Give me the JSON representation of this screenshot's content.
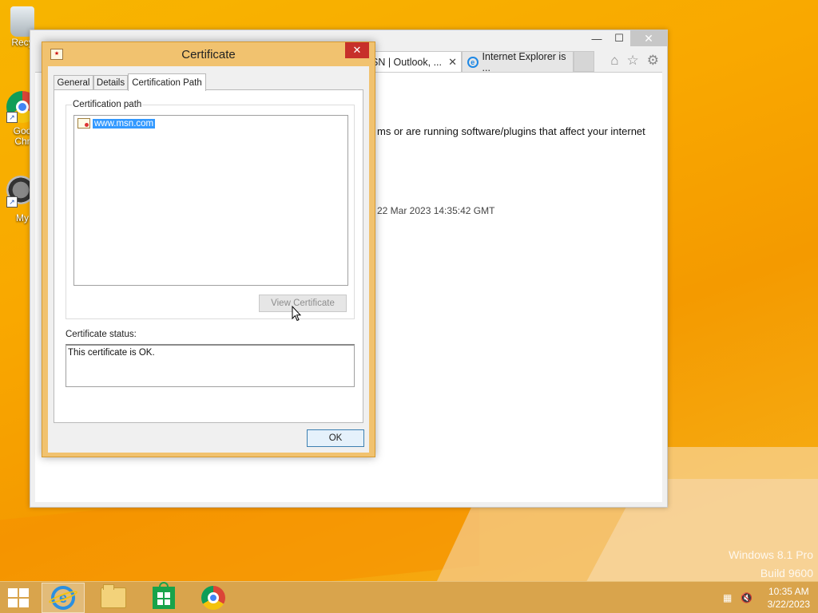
{
  "desktop": {
    "icons": [
      {
        "label": "Recycle Bin",
        "visible_label": "Recy"
      },
      {
        "label": "Google Chrome",
        "visible_label": "Goo\nChr"
      },
      {
        "label": "My",
        "visible_label": "My"
      }
    ],
    "watermark": {
      "line1": "Windows 8.1 Pro",
      "line2": "Build 9600"
    }
  },
  "browser": {
    "tabs": [
      {
        "label": "SN | Outlook, ...",
        "active": true,
        "close": "✕"
      },
      {
        "label": "Internet Explorer is ...",
        "active": false
      }
    ],
    "caption": {
      "minimize": "—",
      "maximize": "☐",
      "close": "✕"
    },
    "toolbar": {
      "home": "⌂",
      "favorites": "☆",
      "settings": "⚙"
    },
    "content": {
      "text_line": "ms or are running software/plugins that affect your internet",
      "timestamp": "22 Mar 2023 14:35:42 GMT"
    }
  },
  "dialog": {
    "title": "Certificate",
    "close_glyph": "✕",
    "tabs": [
      {
        "label": "General",
        "selected": false
      },
      {
        "label": "Details",
        "selected": false
      },
      {
        "label": "Certification Path",
        "selected": true
      }
    ],
    "cert_path_group_label": "Certification path",
    "cert_path_items": [
      {
        "label": "www.msn.com",
        "selected": true
      }
    ],
    "view_certificate_label": "View Certificate",
    "status_label": "Certificate status:",
    "status_text": "This certificate is OK.",
    "ok_label": "OK"
  },
  "taskbar": {
    "pinned": [
      "Internet Explorer",
      "File Explorer",
      "Store",
      "Google Chrome"
    ],
    "clock": {
      "time": "10:35 AM",
      "date": "3/22/2023"
    }
  }
}
